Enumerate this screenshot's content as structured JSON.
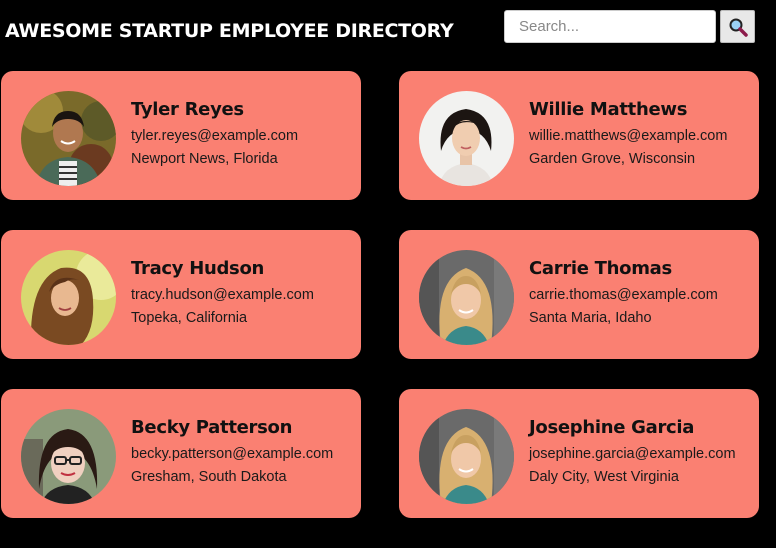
{
  "header": {
    "title": "AWESOME STARTUP EMPLOYEE DIRECTORY",
    "search_placeholder": "Search...",
    "search_icon": "magnifier-icon"
  },
  "employees": [
    {
      "name": "Tyler Reyes",
      "email": "tyler.reyes@example.com",
      "location": "Newport News, Florida"
    },
    {
      "name": "Willie Matthews",
      "email": "willie.matthews@example.com",
      "location": "Garden Grove, Wisconsin"
    },
    {
      "name": "Tracy Hudson",
      "email": "tracy.hudson@example.com",
      "location": "Topeka, California"
    },
    {
      "name": "Carrie Thomas",
      "email": "carrie.thomas@example.com",
      "location": "Santa Maria, Idaho"
    },
    {
      "name": "Becky Patterson",
      "email": "becky.patterson@example.com",
      "location": "Gresham, South Dakota"
    },
    {
      "name": "Josephine Garcia",
      "email": "josephine.garcia@example.com",
      "location": "Daly City, West Virginia"
    }
  ],
  "colors": {
    "background": "#000000",
    "card": "#fa8072",
    "title": "#ffffff"
  }
}
